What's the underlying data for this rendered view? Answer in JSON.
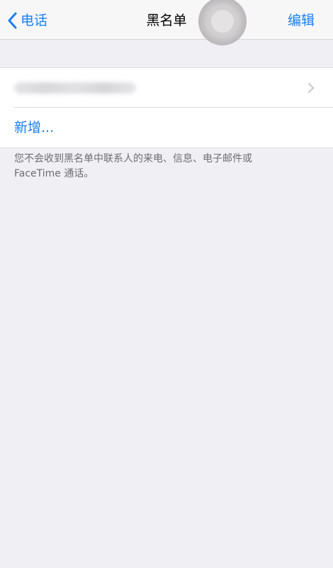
{
  "nav": {
    "back_label": "电话",
    "title": "黑名单",
    "edit_label": "编辑"
  },
  "list": {
    "add_label": "新增..."
  },
  "footer": {
    "line1": "您不会收到黑名单中联系人的来电、信息、电子邮件或",
    "line2": "FaceTime 通话。"
  },
  "colors": {
    "accent": "#1a7ff5",
    "background": "#efeff4",
    "footer_text": "#6d6d72"
  },
  "icons": {
    "back": "chevron-left-icon",
    "row_disclosure": "chevron-right-icon"
  }
}
